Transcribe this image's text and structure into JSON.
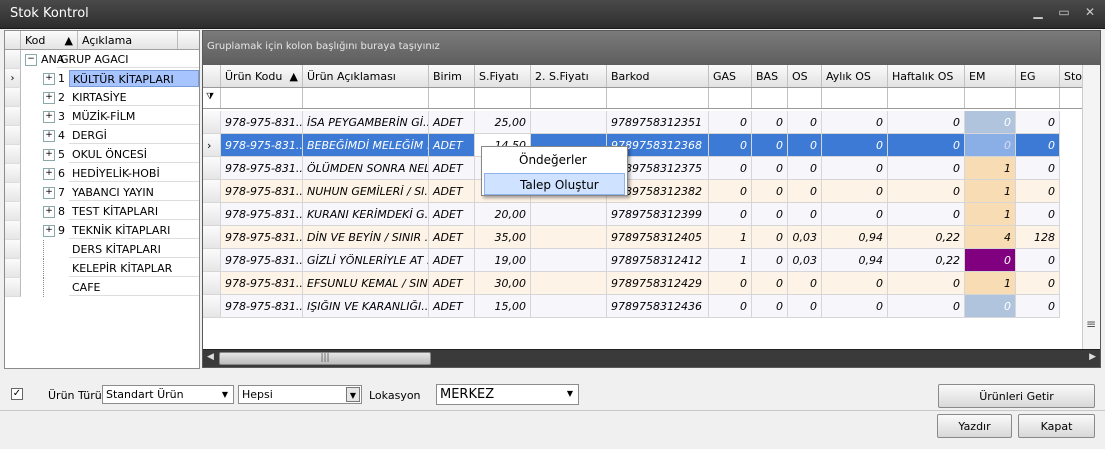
{
  "window": {
    "title": "Stok Kontrol"
  },
  "tree": {
    "headers": [
      "Kod",
      "Açıklama"
    ],
    "root": {
      "code": "ANA",
      "label": "GRUP AGACI"
    },
    "items": [
      {
        "code": "1",
        "label": "KÜLTÜR KİTAPLARI",
        "selected": true
      },
      {
        "code": "2",
        "label": "KIRTASİYE"
      },
      {
        "code": "3",
        "label": "MÜZİK-FİLM"
      },
      {
        "code": "4",
        "label": "DERGİ"
      },
      {
        "code": "5",
        "label": "OKUL ÖNCESİ"
      },
      {
        "code": "6",
        "label": "HEDİYELİK-HOBİ"
      },
      {
        "code": "7",
        "label": "YABANCI YAYIN"
      },
      {
        "code": "8",
        "label": "TEST KİTAPLARI"
      },
      {
        "code": "9",
        "label": "TEKNİK KİTAPLARI"
      },
      {
        "code": "",
        "label": "DERS KİTAPLARI"
      },
      {
        "code": "",
        "label": "KELEPİR KİTAPLAR"
      },
      {
        "code": "",
        "label": "CAFE"
      }
    ]
  },
  "grid": {
    "group_panel_text": "Gruplamak için kolon başlığını buraya taşıyınız",
    "columns": [
      "Ürün Kodu",
      "Ürün Açıklaması",
      "Birim",
      "S.Fiyatı",
      "2. S.Fiyatı",
      "Barkod",
      "GAS",
      "BAS",
      "OS",
      "Aylık OS",
      "Haftalık OS",
      "EM",
      "EG",
      "Sto"
    ],
    "rows": [
      [
        "978-975-831...",
        "İSA PEYGAMBERİN Gİ...",
        "ADET",
        "25,00",
        "",
        "9789758312351",
        "0",
        "0",
        "0",
        "0",
        "0",
        "0",
        "0"
      ],
      [
        "978-975-831...",
        "BEBEĞİMDİ MELEĞİM ...",
        "ADET",
        "14,50",
        "",
        "9789758312368",
        "0",
        "0",
        "0",
        "0",
        "0",
        "0",
        "0"
      ],
      [
        "978-975-831...",
        "ÖLÜMDEN SONRA NEL...",
        "ADET",
        "",
        "",
        "9789758312375",
        "0",
        "0",
        "0",
        "0",
        "0",
        "1",
        "0"
      ],
      [
        "978-975-831...",
        "NUHUN GEMİLERİ / SI...",
        "ADET",
        "",
        "",
        "9789758312382",
        "0",
        "0",
        "0",
        "0",
        "0",
        "1",
        "0"
      ],
      [
        "978-975-831...",
        "KURANI KERİMDEKİ G...",
        "ADET",
        "20,00",
        "",
        "9789758312399",
        "0",
        "0",
        "0",
        "0",
        "0",
        "1",
        "0"
      ],
      [
        "978-975-831...",
        "DİN VE BEYİN / SINIR ...",
        "ADET",
        "35,00",
        "",
        "9789758312405",
        "1",
        "0",
        "0,03",
        "0,94",
        "0,22",
        "4",
        "128"
      ],
      [
        "978-975-831...",
        "GİZLİ YÖNLERİYLE AT ...",
        "ADET",
        "19,00",
        "",
        "9789758312412",
        "1",
        "0",
        "0,03",
        "0,94",
        "0,22",
        "0",
        "0"
      ],
      [
        "978-975-831...",
        "EFSUNLU KEMAL / SIN...",
        "ADET",
        "30,00",
        "",
        "9789758312429",
        "0",
        "0",
        "0",
        "0",
        "0",
        "1",
        "0"
      ],
      [
        "978-975-831...",
        "IŞIĞIN VE KARANLIĞI...",
        "ADET",
        "15,00",
        "",
        "9789758312436",
        "0",
        "0",
        "0",
        "0",
        "0",
        "0",
        "0"
      ]
    ]
  },
  "context_menu": {
    "items": [
      "Öndeğerler",
      "Talep Oluştur"
    ]
  },
  "bottom": {
    "urun_turu_label": "Ürün Türü",
    "urun_turu_value": "Standart Ürün",
    "filter_value": "Hepsi",
    "lokasyon_label": "Lokasyon",
    "lokasyon_value": "MERKEZ",
    "btn_getir": "Ürünleri Getir",
    "btn_yazdir": "Yazdır",
    "btn_kapat": "Kapat"
  },
  "colors": {
    "selected_row": "#3c7ad6",
    "em_purple": "#800080",
    "em_orange": "#f7dcb4",
    "em_blue": "#b0c4de"
  }
}
